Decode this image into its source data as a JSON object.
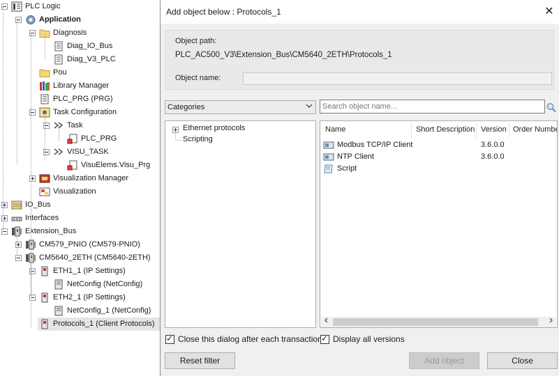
{
  "tree": {
    "items": [
      {
        "label": "PLC Logic",
        "level": 0,
        "bold": false,
        "icon": "plc-logic-icon"
      },
      {
        "label": "Application",
        "level": 1,
        "bold": true,
        "icon": "application-gear-icon"
      },
      {
        "label": "Diagnosis",
        "level": 2,
        "bold": false,
        "icon": "folder-icon"
      },
      {
        "label": "Diag_IO_Bus",
        "level": 3,
        "bold": false,
        "icon": "list-icon"
      },
      {
        "label": "Diag_V3_PLC",
        "level": 3,
        "bold": false,
        "icon": "list-icon"
      },
      {
        "label": "Pou",
        "level": 2,
        "bold": false,
        "icon": "folder-icon"
      },
      {
        "label": "Library Manager",
        "level": 2,
        "bold": false,
        "icon": "library-icon"
      },
      {
        "label": "PLC_PRG (PRG)",
        "level": 2,
        "bold": false,
        "icon": "program-icon"
      },
      {
        "label": "Task Configuration",
        "level": 2,
        "bold": false,
        "icon": "task-config-icon"
      },
      {
        "label": "Task",
        "level": 3,
        "bold": false,
        "icon": "task-icon"
      },
      {
        "label": "PLC_PRG",
        "level": 4,
        "bold": false,
        "icon": "program-call-icon"
      },
      {
        "label": "VISU_TASK",
        "level": 3,
        "bold": false,
        "icon": "task-icon"
      },
      {
        "label": "VisuElems.Visu_Prg",
        "level": 4,
        "bold": false,
        "icon": "program-call-icon"
      },
      {
        "label": "Visualization Manager",
        "level": 2,
        "bold": false,
        "icon": "visu-manager-icon"
      },
      {
        "label": "Visualization",
        "level": 2,
        "bold": false,
        "icon": "visualization-icon"
      },
      {
        "label": "IO_Bus",
        "level": 0,
        "bold": false,
        "icon": "io-bus-icon"
      },
      {
        "label": "Interfaces",
        "level": 0,
        "bold": false,
        "icon": "interfaces-icon"
      },
      {
        "label": "Extension_Bus",
        "level": 0,
        "bold": false,
        "icon": "extension-bus-icon"
      },
      {
        "label": "CM579_PNIO (CM579-PNIO)",
        "level": 1,
        "bold": false,
        "icon": "device-module-icon"
      },
      {
        "label": "CM5640_2ETH (CM5640-2ETH)",
        "level": 1,
        "bold": false,
        "icon": "device-module-icon"
      },
      {
        "label": "ETH1_1 (IP Settings)",
        "level": 2,
        "bold": false,
        "icon": "ethernet-port-icon"
      },
      {
        "label": "NetConfig (NetConfig)",
        "level": 3,
        "bold": false,
        "icon": "netconfig-icon"
      },
      {
        "label": "ETH2_1 (IP Settings)",
        "level": 2,
        "bold": false,
        "icon": "ethernet-port-icon"
      },
      {
        "label": "NetConfig_1 (NetConfig)",
        "level": 3,
        "bold": false,
        "icon": "netconfig-icon"
      },
      {
        "label": "Protocols_1 (Client Protocols)",
        "level": 2,
        "bold": false,
        "icon": "ethernet-port-icon",
        "selected": true
      }
    ]
  },
  "dialog": {
    "title": "Add object below : Protocols_1",
    "close_glyph": "✕",
    "object_path_label": "Object path:",
    "object_path_value": "PLC_AC500_V3\\Extension_Bus\\CM5640_2ETH\\Protocols_1",
    "object_name_label": "Object name:",
    "object_name_value": "",
    "categories_value": "Categories",
    "search_placeholder": "Search object name...",
    "category_tree": [
      {
        "label": "Ethernet protocols",
        "expandable": true
      },
      {
        "label": "Scripting",
        "expandable": false
      }
    ],
    "columns": [
      "Name",
      "Short Description",
      "Version",
      "Order Number"
    ],
    "objects": [
      {
        "name": "Modbus TCP/IP Client",
        "version": "3.6.0.0",
        "icon": "module-icon"
      },
      {
        "name": "NTP Client",
        "version": "3.6.0.0",
        "icon": "module-icon"
      },
      {
        "name": "Script",
        "version": "",
        "icon": "script-icon"
      }
    ],
    "close_after_label": "Close this dialog after each transaction",
    "display_all_label": "Display all versions",
    "reset_filter_label": "Reset filter",
    "add_object_label": "Add object",
    "close_label": "Close"
  }
}
